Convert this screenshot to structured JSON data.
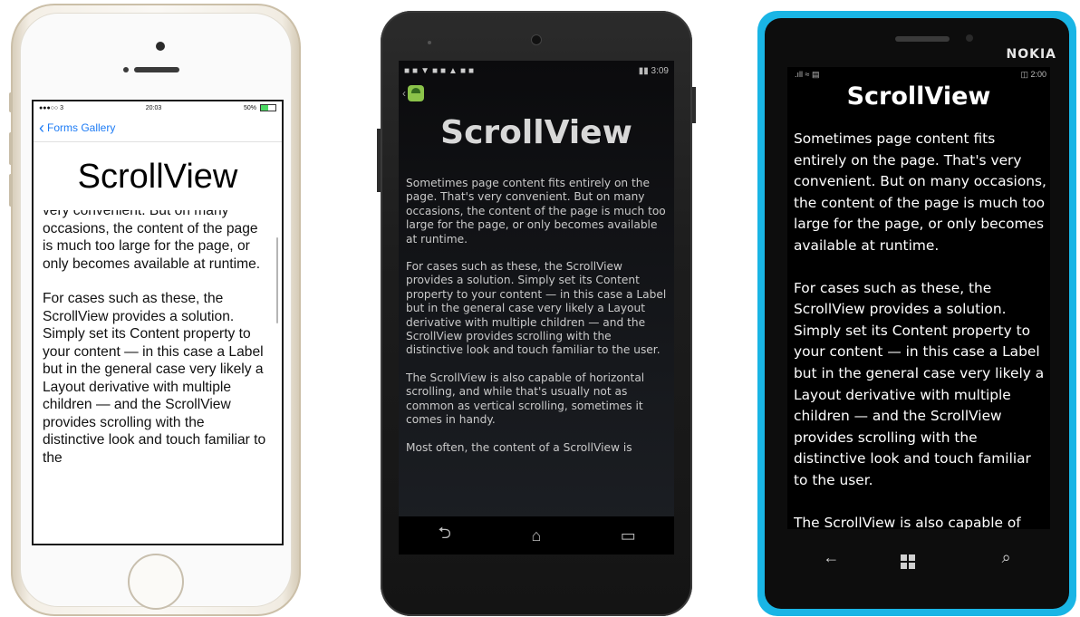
{
  "paragraphs": [
    "Sometimes page content fits entirely on the page. That's very convenient. But on many occasions, the content of the page is much too large for the page, or only becomes available at runtime.",
    "For cases such as these, the ScrollView provides a solution. Simply set its Content property to your content — in this case a Label but in the general case very likely a Layout derivative with multiple children — and the ScrollView provides scrolling with the distinctive look and touch familiar to the user.",
    "The ScrollView is also capable of horizontal scrolling, and while that's usually not as common as vertical scrolling, sometimes it comes in handy.",
    "Most often, the content of a ScrollView is"
  ],
  "ios": {
    "status_carrier": "●●●○○ 3",
    "status_time": "20:03",
    "status_battery": "50%",
    "back_label": "Forms Gallery",
    "title": "ScrollView",
    "visible_text": [
      "very convenient. But on many occasions, the content of the page is much too large for the page, or only becomes available at runtime.",
      "For cases such as these, the ScrollView provides a solution. Simply set its Content property to your content — in this case a Label but in the general case very likely a Layout derivative with multiple children — and the ScrollView provides scrolling with the distinctive look and touch familiar to the"
    ]
  },
  "android": {
    "status_time": "3:09",
    "title": "ScrollView",
    "visible_text": [
      "Sometimes page content fits entirely on the page. That's very convenient. But on many occasions, the content of the page is much too large for the page, or only becomes available at runtime.",
      "For cases such as these, the ScrollView provides a solution. Simply set its Content property to your content — in this case a Label but in the general case very likely a Layout derivative with multiple children — and the ScrollView provides scrolling with the distinctive look and touch familiar to the user.",
      "The ScrollView is also capable of horizontal scrolling, and while that's usually not as common as vertical scrolling, sometimes it comes in handy.",
      "Most often, the content of a ScrollView is"
    ],
    "nav_back": "⮌",
    "nav_home": "⌂",
    "nav_recent": "▭"
  },
  "windows": {
    "brand": "NOKIA",
    "status_time": "2:00",
    "title": "ScrollView",
    "visible_text": [
      "Sometimes page content fits entirely on the page. That's very convenient. But on many occasions, the content of the page is much too large for the page, or only becomes available at runtime.",
      "For cases such as these, the ScrollView provides a solution. Simply set its Content property to your content — in this case a Label but in the general case very likely a Layout derivative with multiple children — and the ScrollView provides scrolling with the distinctive look and touch familiar to the user.",
      "The ScrollView is also capable of horizontal scrolling, and while that's"
    ],
    "nav_back": "←",
    "nav_search": "⌕"
  },
  "colors": {
    "ios_link": "#1e7cf5",
    "nokia_frame": "#19b5e5",
    "android_logo": "#8bc34a"
  }
}
